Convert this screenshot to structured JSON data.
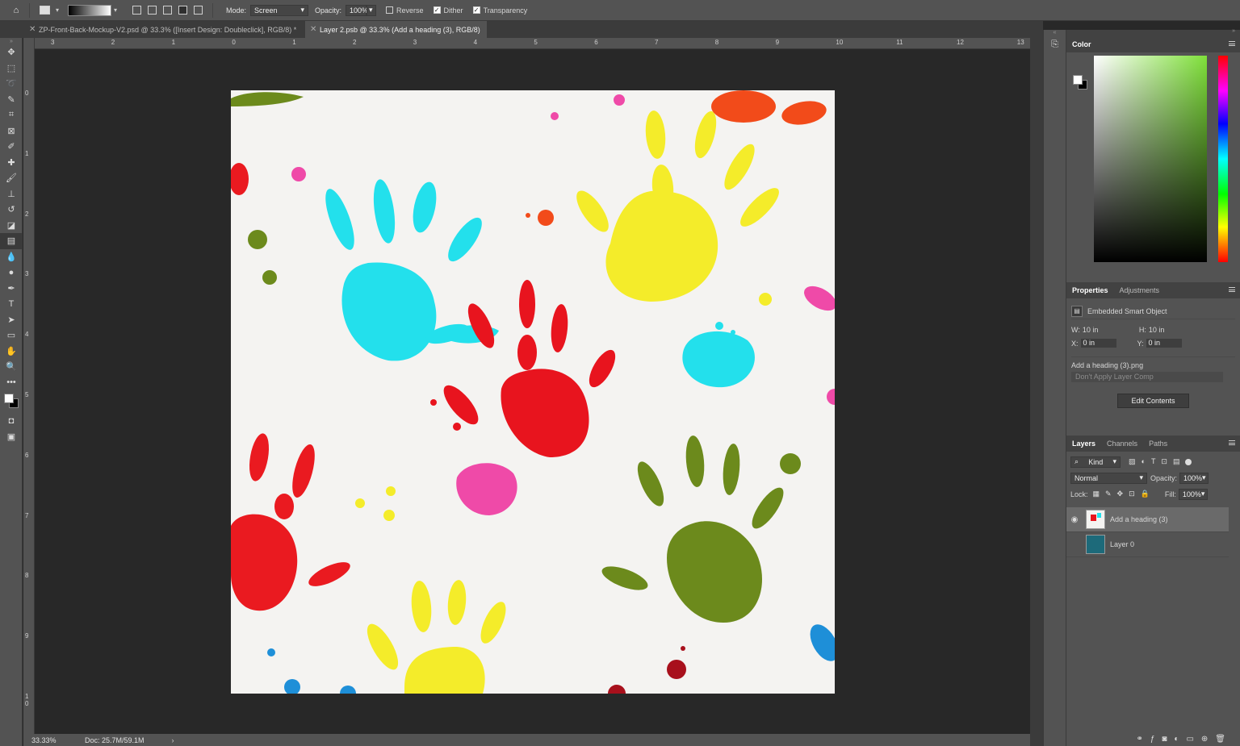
{
  "options": {
    "mode_label": "Mode:",
    "mode_value": "Screen",
    "opacity_label": "Opacity:",
    "opacity_value": "100%",
    "reverse_label": "Reverse",
    "dither_label": "Dither",
    "transparency_label": "Transparency"
  },
  "tabs": [
    {
      "label": "ZP-Front-Back-Mockup-V2.psd @ 33.3% ([Insert Design: Doubleclick], RGB/8) *"
    },
    {
      "label": "Layer 2.psb @ 33.3% (Add a heading (3), RGB/8)"
    }
  ],
  "ruler_top": [
    "3",
    "2",
    "1",
    "0",
    "1",
    "2",
    "3",
    "4",
    "5",
    "6",
    "7",
    "8",
    "9",
    "10",
    "11",
    "12",
    "13"
  ],
  "ruler_left": [
    "0",
    "1",
    "2",
    "3",
    "4",
    "5",
    "6",
    "7",
    "8",
    "9",
    "1\n0"
  ],
  "status": {
    "zoom": "33.33%",
    "doc": "Doc: 25.7M/59.1M"
  },
  "color_panel": {
    "title": "Color"
  },
  "properties": {
    "tab": "Properties",
    "tab2": "Adjustments",
    "type": "Embedded Smart Object",
    "w_label": "W:",
    "w_value": "10 in",
    "h_label": "H:",
    "h_value": "10 in",
    "x_label": "X:",
    "x_value": "0 in",
    "y_label": "Y:",
    "y_value": "0 in",
    "file": "Add a heading (3).png",
    "comp": "Don't Apply Layer Comp",
    "edit_button": "Edit Contents"
  },
  "layers": {
    "tab": "Layers",
    "tab2": "Channels",
    "tab3": "Paths",
    "kind": "Kind",
    "blend": "Normal",
    "opacity_label": "Opacity:",
    "opacity_value": "100%",
    "lock_label": "Lock:",
    "fill_label": "Fill:",
    "fill_value": "100%",
    "items": [
      {
        "name": "Add a heading (3)"
      },
      {
        "name": "Layer 0"
      }
    ]
  },
  "colors": {
    "cyan": "#23e0ec",
    "yellow": "#f4ec2a",
    "red": "#e8141e",
    "olive": "#6c8a1c",
    "pink": "#ef4aa8"
  }
}
